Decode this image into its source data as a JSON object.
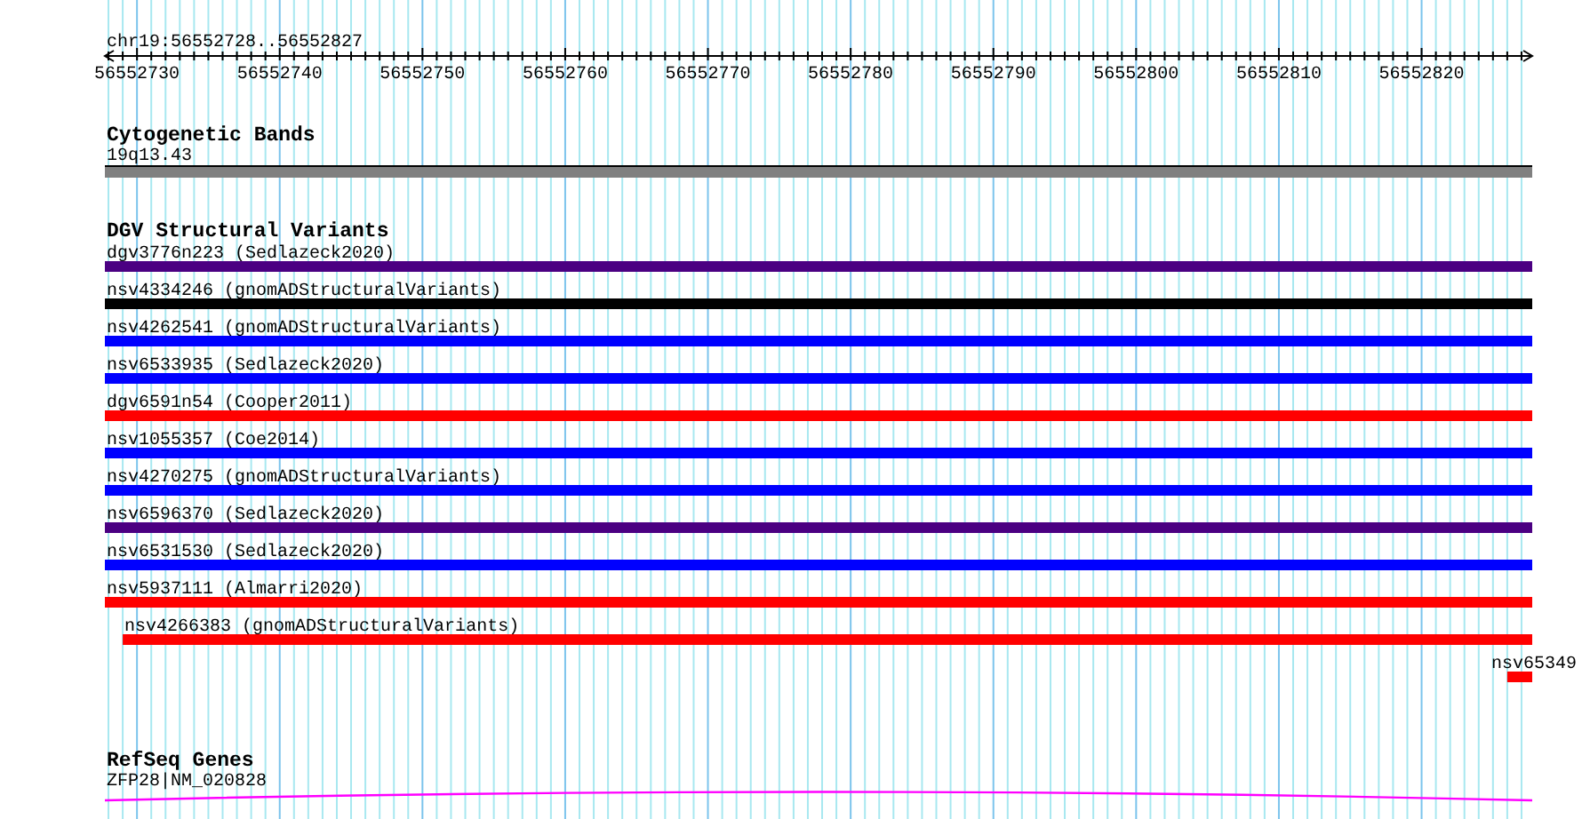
{
  "ruler": {
    "region": "chr19:56552728..56552827",
    "tick_labels": [
      "56552730",
      "56552740",
      "56552750",
      "56552760",
      "56552770",
      "56552780",
      "56552790",
      "56552800",
      "56552810",
      "56552820"
    ]
  },
  "tracks": [
    {
      "kind": "cytoband",
      "title": "Cytogenetic Bands",
      "features": [
        {
          "label": "19q13.43",
          "color": "#808080",
          "kind": "full"
        }
      ]
    },
    {
      "kind": "variants",
      "title": "DGV Structural Variants",
      "features": [
        {
          "label": "dgv3776n223 (Sedlazeck2020)",
          "color": "#4b0082",
          "kind": "full"
        },
        {
          "label": "nsv4334246 (gnomADStructuralVariants)",
          "color": "#000000",
          "kind": "full"
        },
        {
          "label": "nsv4262541 (gnomADStructuralVariants)",
          "color": "#0000ff",
          "kind": "full"
        },
        {
          "label": "nsv6533935 (Sedlazeck2020)",
          "color": "#0000ff",
          "kind": "full"
        },
        {
          "label": "dgv6591n54 (Cooper2011)",
          "color": "#ff0000",
          "kind": "full"
        },
        {
          "label": "nsv1055357 (Coe2014)",
          "color": "#0000ff",
          "kind": "full"
        },
        {
          "label": "nsv4270275 (gnomADStructuralVariants)",
          "color": "#0000ff",
          "kind": "full"
        },
        {
          "label": "nsv6596370 (Sedlazeck2020)",
          "color": "#4b0082",
          "kind": "full"
        },
        {
          "label": "nsv6531530 (Sedlazeck2020)",
          "color": "#0000ff",
          "kind": "full"
        },
        {
          "label": "nsv5937111 (Almarri2020)",
          "color": "#ff0000",
          "kind": "full"
        },
        {
          "label": "nsv4266383 (gnomADStructuralVariants)",
          "color": "#ff0000",
          "kind": "inset"
        },
        {
          "label": "nsv65349",
          "color": "#ff0000",
          "kind": "tail"
        }
      ]
    },
    {
      "kind": "gene",
      "title": "RefSeq Genes",
      "features": [
        {
          "label": "ZFP28|NM_020828",
          "color": "#ff00ff",
          "kind": "full"
        }
      ]
    }
  ]
}
